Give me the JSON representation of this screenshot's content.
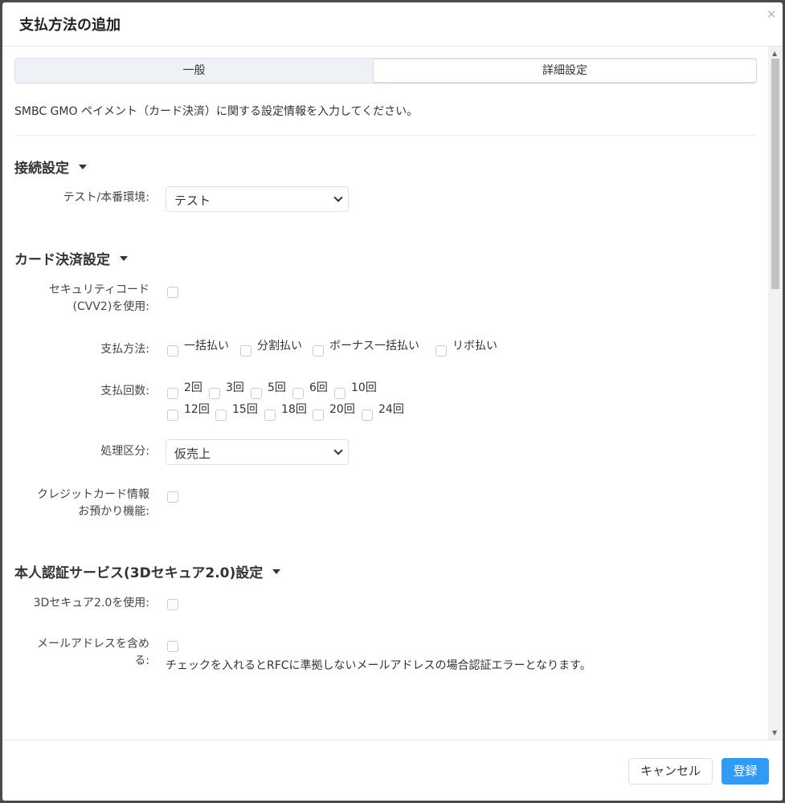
{
  "dialog": {
    "title": "支払方法の追加",
    "close_icon": "×"
  },
  "tabs": [
    {
      "label": "一般"
    },
    {
      "label": "詳細設定"
    }
  ],
  "description": "SMBC GMO ペイメント（カード決済）に関する設定情報を入力してください。",
  "sections": {
    "connection": {
      "title": "接続設定",
      "env_label": "テスト/本番環境:",
      "env_value": "テスト"
    },
    "card": {
      "title": "カード決済設定",
      "cvv_label_1": "セキュリティコード",
      "cvv_label_2": "(CVV2)を使用:",
      "payment_method_label": "支払方法:",
      "payment_methods": [
        "一括払い",
        "分割払い",
        "ボーナス一括払い",
        "リボ払い"
      ],
      "installments_label": "支払回数:",
      "installments": [
        "2回",
        "3回",
        "5回",
        "6回",
        "10回",
        "12回",
        "15回",
        "18回",
        "20回",
        "24回"
      ],
      "process_label": "処理区分:",
      "process_value": "仮売上",
      "credit_store_label_1": "クレジットカード情報",
      "credit_store_label_2": "お預かり機能:"
    },
    "auth": {
      "title": "本人認証サービス(3Dセキュア2.0)設定",
      "use_3ds_label": "3Dセキュア2.0を使用:",
      "email_label_1": "メールアドレスを含め",
      "email_label_2": "る:",
      "email_note": "チェックを入れるとRFCに準拠しないメールアドレスの場合認証エラーとなります。"
    }
  },
  "footer": {
    "cancel_label": "キャンセル",
    "submit_label": "登録"
  },
  "colors": {
    "primary": "#2f9bf2",
    "border": "#dcdfe6"
  }
}
